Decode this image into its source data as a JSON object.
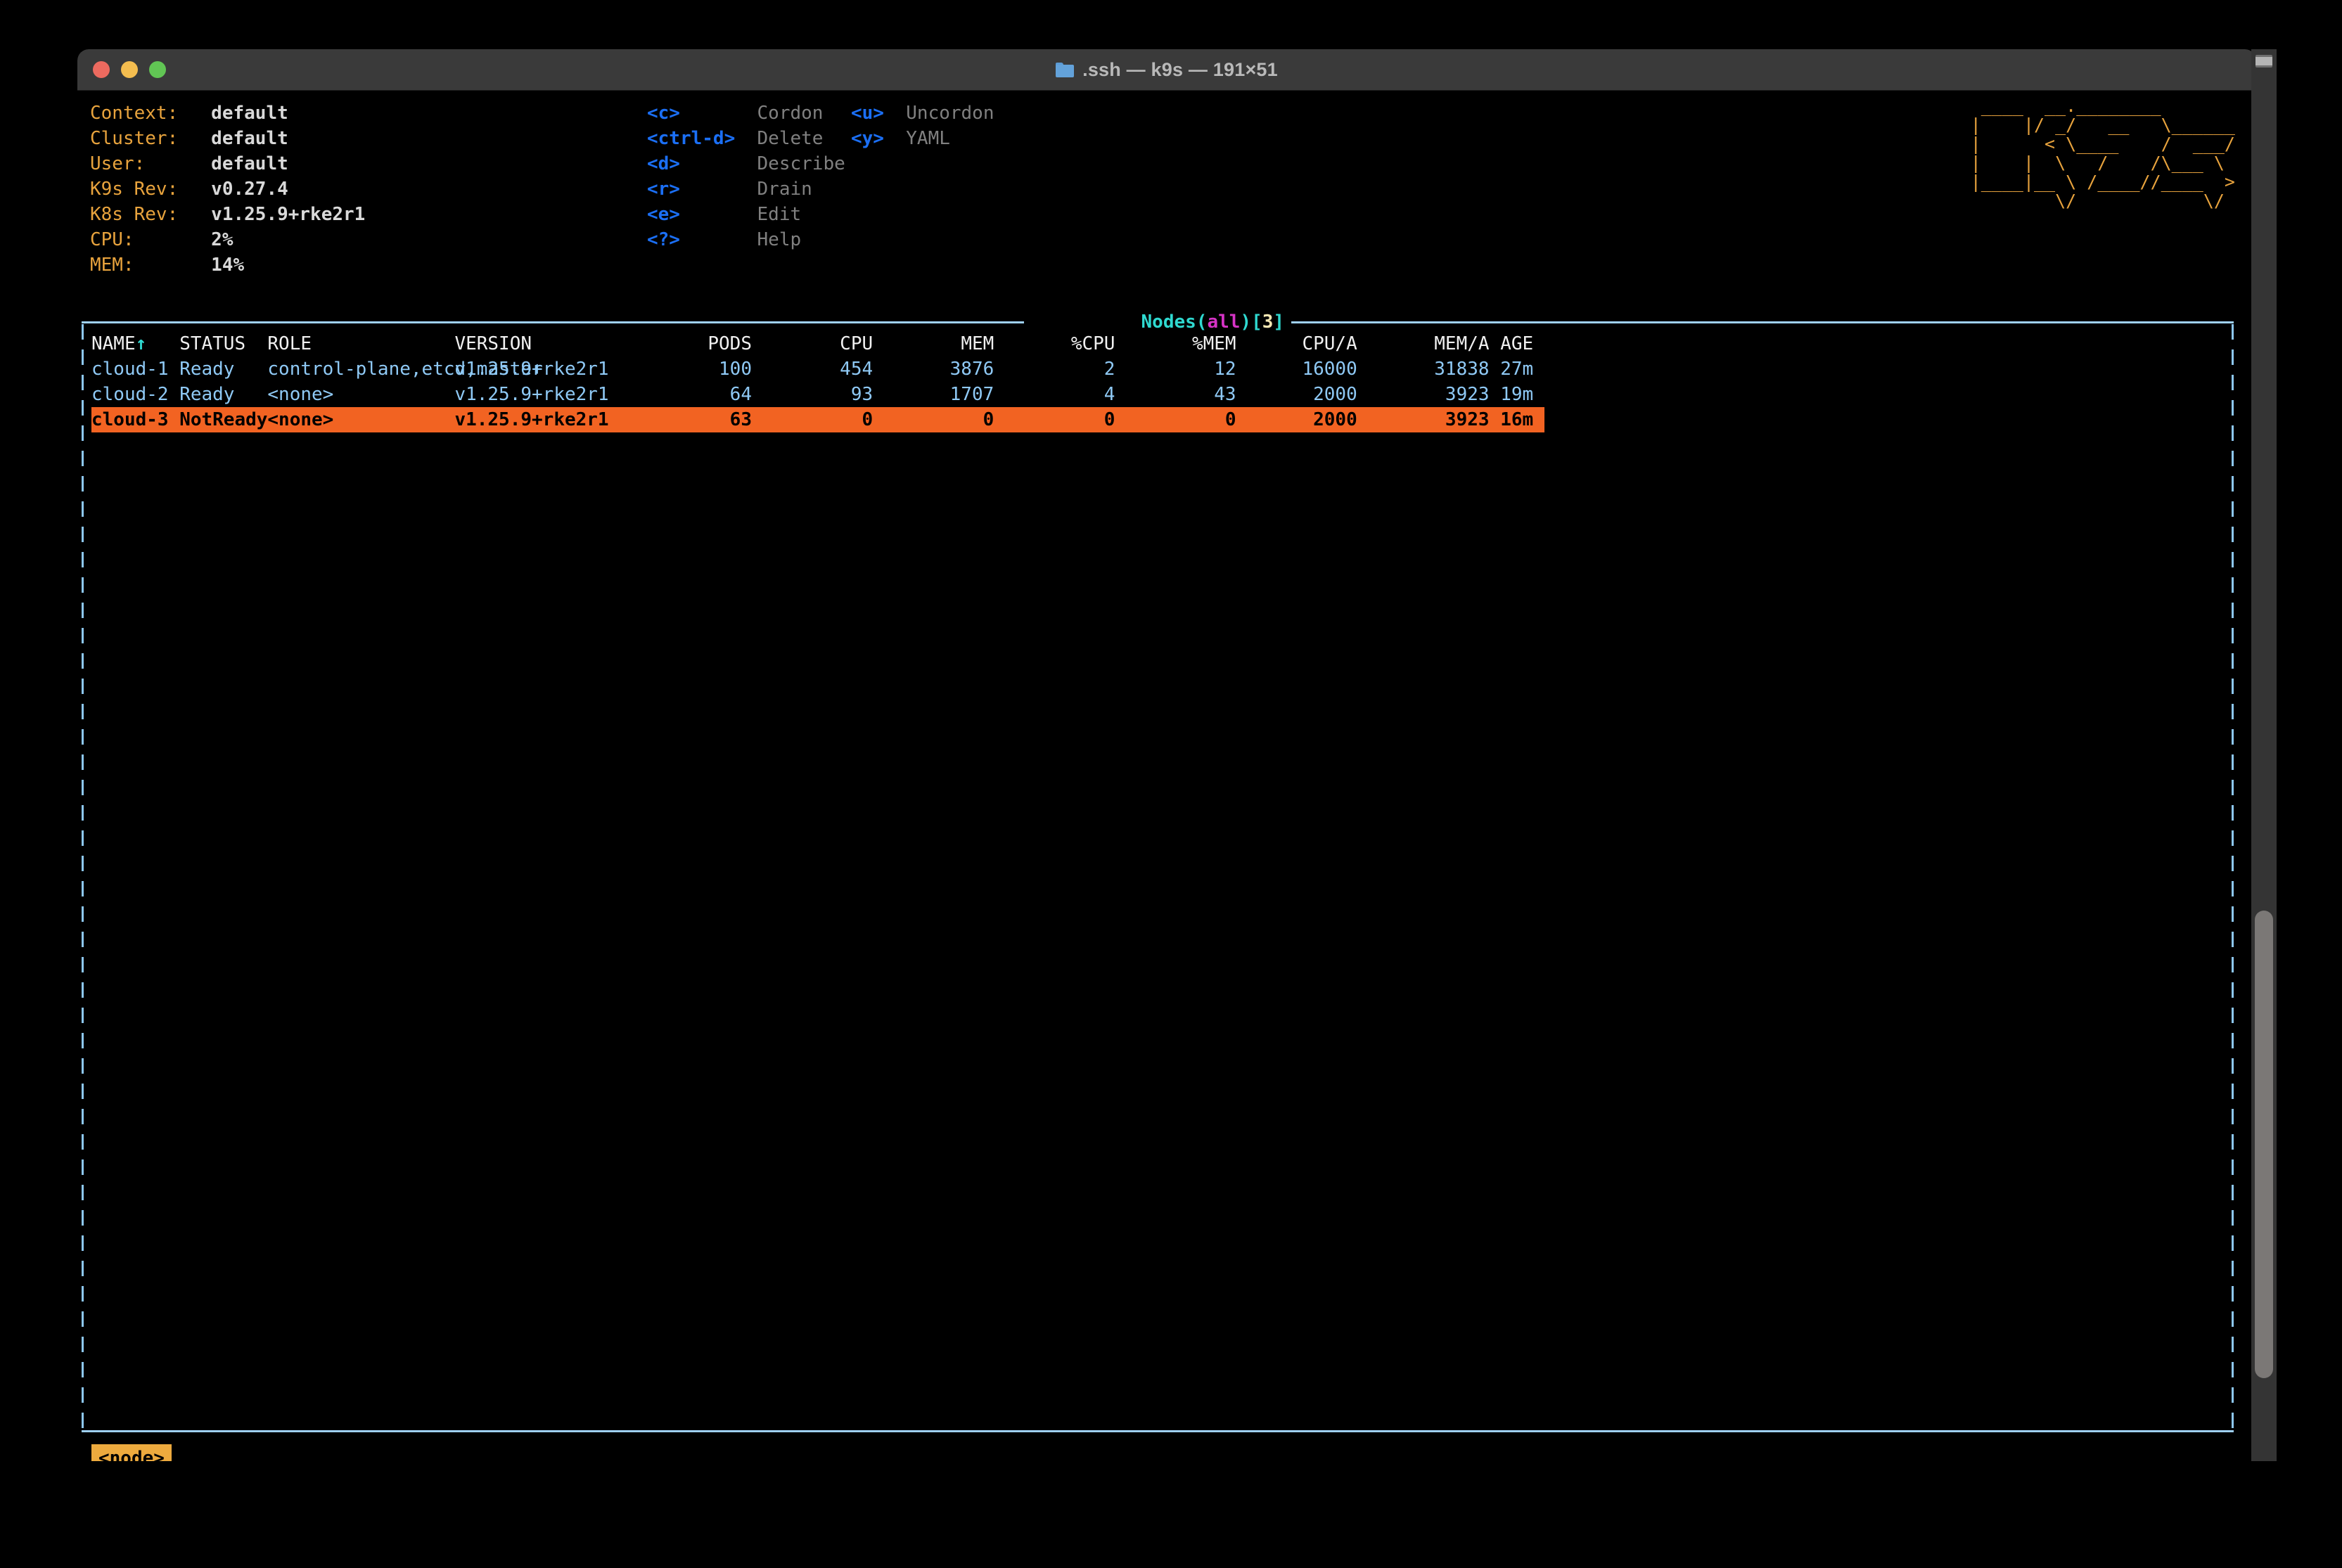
{
  "window": {
    "title": ".ssh — k9s — 191×51",
    "icon": "folder-icon",
    "traffic_lights": [
      "close",
      "minimize",
      "maximize"
    ]
  },
  "info": {
    "rows": [
      {
        "label": "Context:",
        "value": "default"
      },
      {
        "label": "Cluster:",
        "value": "default"
      },
      {
        "label": "User:",
        "value": "default"
      },
      {
        "label": "K9s Rev:",
        "value": "v0.27.4"
      },
      {
        "label": "K8s Rev:",
        "value": "v1.25.9+rke2r1"
      },
      {
        "label": "CPU:",
        "value": "2%"
      },
      {
        "label": "MEM:",
        "value": "14%"
      }
    ]
  },
  "shortcuts": {
    "column1": [
      {
        "key": "<c>",
        "action": "Cordon"
      },
      {
        "key": "<ctrl-d>",
        "action": "Delete"
      },
      {
        "key": "<d>",
        "action": "Describe"
      },
      {
        "key": "<r>",
        "action": "Drain"
      },
      {
        "key": "<e>",
        "action": "Edit"
      },
      {
        "key": "<?>",
        "action": "Help"
      }
    ],
    "column2": [
      {
        "key": "<u>",
        "action": "Uncordon"
      },
      {
        "key": "<y>",
        "action": "YAML"
      }
    ]
  },
  "logo": {
    "art": " ____  __.________       \n|    |/ _/   __   \\______\n|      < \\____    /  ___/\n|    |  \\   /    /\\___ \\ \n|____|__ \\ /____//____  >\n        \\/            \\/ ",
    "color": "#e8a33d"
  },
  "panel": {
    "title_prefix": "Nodes",
    "title_scope": "(all)",
    "title_count": "[3]"
  },
  "table": {
    "columns": [
      {
        "key": "name",
        "label": "NAME",
        "align": "left",
        "sorted": true,
        "sort_arrow": "↑"
      },
      {
        "key": "status",
        "label": "STATUS",
        "align": "left"
      },
      {
        "key": "role",
        "label": "ROLE",
        "align": "left"
      },
      {
        "key": "version",
        "label": "VERSION",
        "align": "left"
      },
      {
        "key": "pods",
        "label": "PODS",
        "align": "right"
      },
      {
        "key": "cpu",
        "label": "CPU",
        "align": "right"
      },
      {
        "key": "mem",
        "label": "MEM",
        "align": "right"
      },
      {
        "key": "pcpu",
        "label": "%CPU",
        "align": "right"
      },
      {
        "key": "pmem",
        "label": "%MEM",
        "align": "right"
      },
      {
        "key": "cpua",
        "label": "CPU/A",
        "align": "right"
      },
      {
        "key": "mema",
        "label": "MEM/A",
        "align": "right"
      },
      {
        "key": "age",
        "label": "AGE",
        "align": "left"
      }
    ],
    "rows": [
      {
        "name": "cloud-1",
        "status": "Ready",
        "role": "control-plane,etcd,master",
        "version": "v1.25.9+rke2r1",
        "pods": "100",
        "cpu": "454",
        "mem": "3876",
        "pcpu": "2",
        "pmem": "12",
        "cpua": "16000",
        "mema": "31838",
        "age": "27m",
        "selected": false
      },
      {
        "name": "cloud-2",
        "status": "Ready",
        "role": "<none>",
        "version": "v1.25.9+rke2r1",
        "pods": "64",
        "cpu": "93",
        "mem": "1707",
        "pcpu": "4",
        "pmem": "43",
        "cpua": "2000",
        "mema": "3923",
        "age": "19m",
        "selected": false
      },
      {
        "name": "cloud-3",
        "status": "NotReady",
        "role": "<none>",
        "version": "v1.25.9+rke2r1",
        "pods": "63",
        "cpu": "0",
        "mem": "0",
        "pcpu": "0",
        "pmem": "0",
        "cpua": "2000",
        "mema": "3923",
        "age": "16m",
        "selected": true
      }
    ]
  },
  "command_prompt": {
    "value": "<node>"
  },
  "colors": {
    "selected_row": "#f26322",
    "accent_orange": "#e8a33d",
    "key_blue": "#1b6ff5",
    "row_blue": "#8fc9f5",
    "border_blue": "#8ec8f3",
    "title_cyan": "#2fd9d0",
    "title_magenta": "#d633c6",
    "title_yellow": "#f4e7b3",
    "background": "#000000"
  }
}
